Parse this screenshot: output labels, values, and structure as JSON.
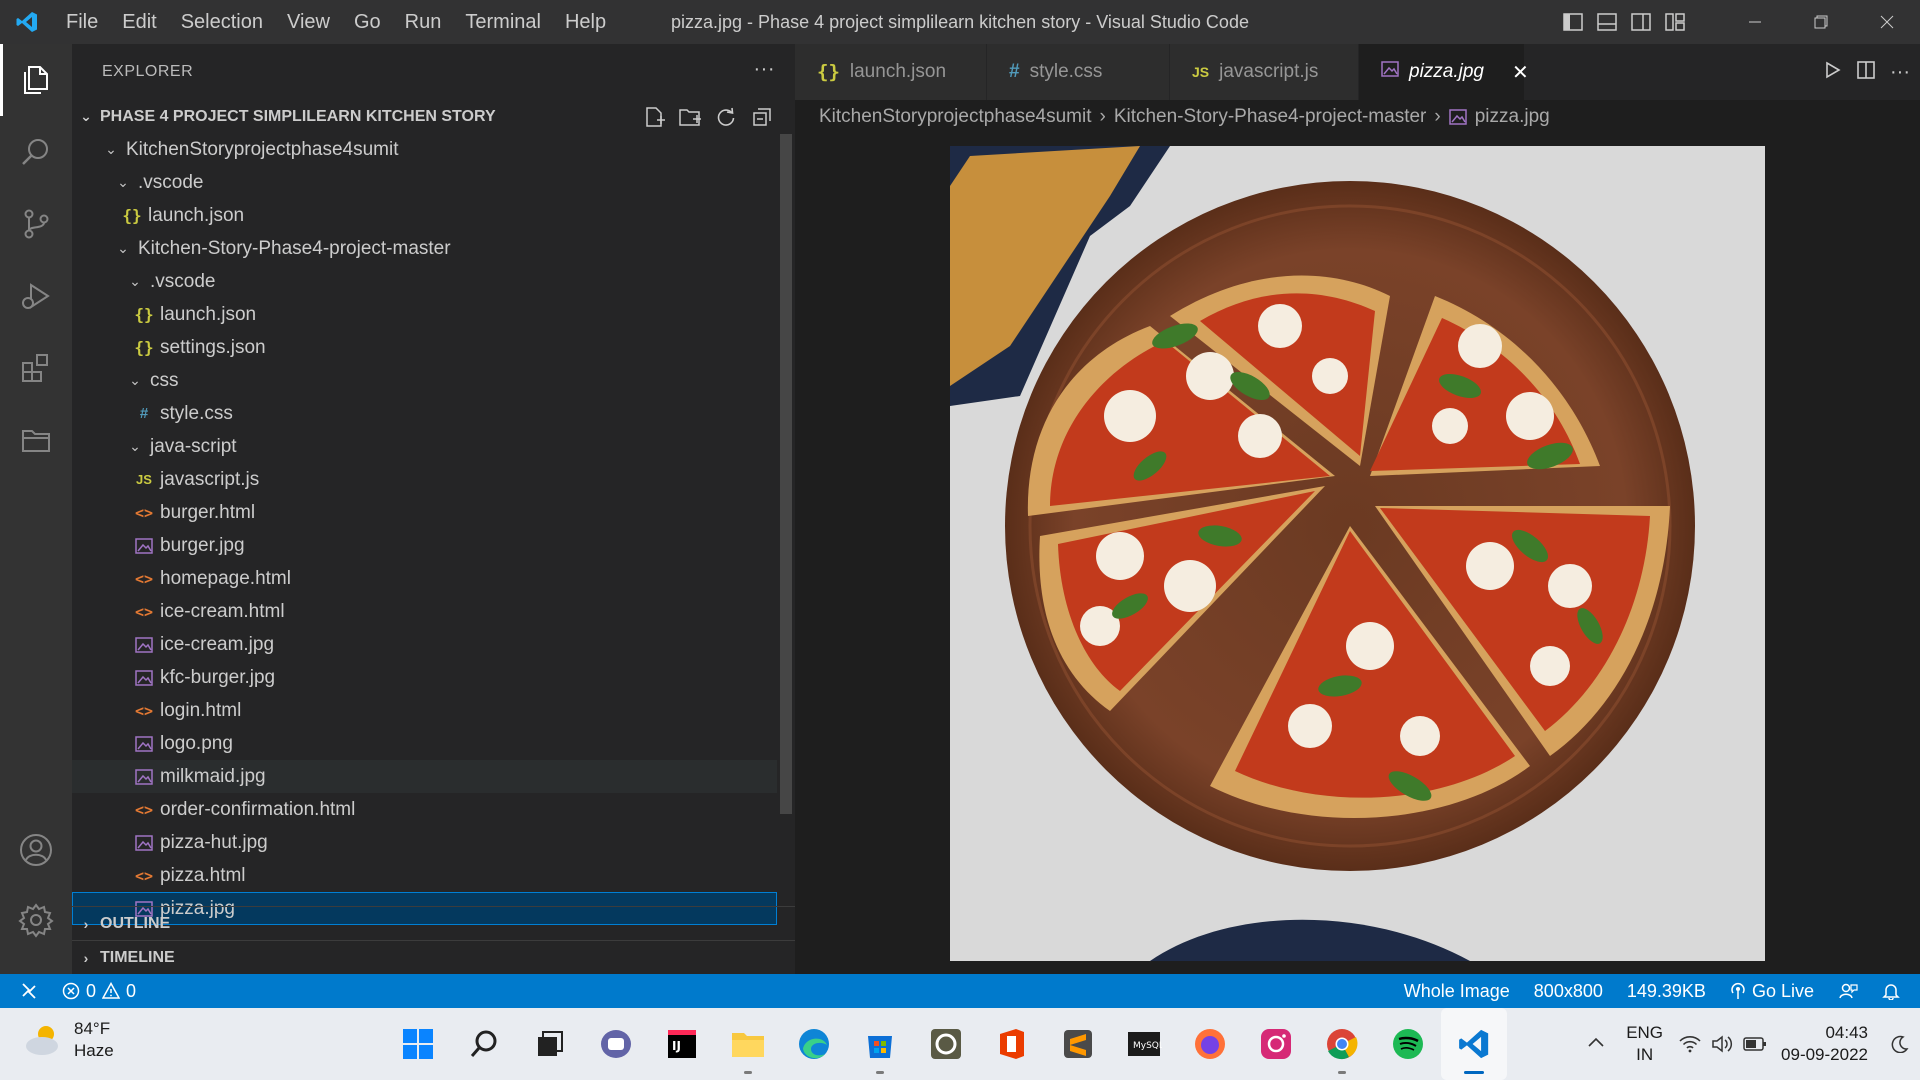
{
  "window": {
    "title": "pizza.jpg - Phase 4 project simplilearn kitchen story - Visual Studio Code",
    "menu": [
      "File",
      "Edit",
      "Selection",
      "View",
      "Go",
      "Run",
      "Terminal",
      "Help"
    ]
  },
  "sidebar": {
    "header": "EXPLORER",
    "more": "···",
    "project_title": "PHASE 4 PROJECT SIMPLILEARN KITCHEN STORY",
    "tree": [
      {
        "label": "KitchenStoryprojectphase4sumit",
        "type": "folder",
        "open": true,
        "level": 1
      },
      {
        "label": ".vscode",
        "type": "folder",
        "open": true,
        "level": 2
      },
      {
        "label": "launch.json",
        "type": "json",
        "level": 2
      },
      {
        "label": "Kitchen-Story-Phase4-project-master",
        "type": "folder",
        "open": true,
        "level": 2
      },
      {
        "label": ".vscode",
        "type": "folder",
        "open": true,
        "level": 3
      },
      {
        "label": "launch.json",
        "type": "json",
        "level": 3
      },
      {
        "label": "settings.json",
        "type": "json",
        "level": 3
      },
      {
        "label": "css",
        "type": "folder",
        "open": true,
        "level": 3
      },
      {
        "label": "style.css",
        "type": "css",
        "level": 3
      },
      {
        "label": "java-script",
        "type": "folder",
        "open": true,
        "level": 3
      },
      {
        "label": "javascript.js",
        "type": "js",
        "level": 3
      },
      {
        "label": "burger.html",
        "type": "html",
        "level": 3
      },
      {
        "label": "burger.jpg",
        "type": "img",
        "level": 3
      },
      {
        "label": "homepage.html",
        "type": "html",
        "level": 3
      },
      {
        "label": "ice-cream.html",
        "type": "html",
        "level": 3
      },
      {
        "label": "ice-cream.jpg",
        "type": "img",
        "level": 3
      },
      {
        "label": "kfc-burger.jpg",
        "type": "img",
        "level": 3
      },
      {
        "label": "login.html",
        "type": "html",
        "level": 3
      },
      {
        "label": "logo.png",
        "type": "img",
        "level": 3
      },
      {
        "label": "milkmaid.jpg",
        "type": "img",
        "level": 3,
        "hover": true
      },
      {
        "label": "order-confirmation.html",
        "type": "html",
        "level": 3
      },
      {
        "label": "pizza-hut.jpg",
        "type": "img",
        "level": 3
      },
      {
        "label": "pizza.html",
        "type": "html",
        "level": 3
      },
      {
        "label": "pizza.jpg",
        "type": "img",
        "level": 3,
        "selected": true
      }
    ],
    "outline": "OUTLINE",
    "timeline": "TIMELINE"
  },
  "tabs": [
    {
      "label": "launch.json",
      "icon": "{}",
      "active": false
    },
    {
      "label": "style.css",
      "icon": "#",
      "active": false
    },
    {
      "label": "javascript.js",
      "icon": "JS",
      "active": false
    },
    {
      "label": "pizza.jpg",
      "icon": "img",
      "active": true
    }
  ],
  "breadcrumb": [
    "KitchenStoryprojectphase4sumit",
    "Kitchen-Story-Phase4-project-master",
    "pizza.jpg"
  ],
  "statusbar": {
    "errors": "0",
    "warnings": "0",
    "zoom": "Whole Image",
    "dimensions": "800x800",
    "size": "149.39KB",
    "golive": "Go Live"
  },
  "taskbar": {
    "temp": "84°F",
    "weather": "Haze",
    "lang1": "ENG",
    "lang2": "IN",
    "time": "04:43",
    "date": "09-09-2022",
    "apps": [
      {
        "name": "start-icon",
        "active": false,
        "dot": false
      },
      {
        "name": "search-icon",
        "active": false,
        "dot": false
      },
      {
        "name": "task-view-icon",
        "active": false,
        "dot": false
      },
      {
        "name": "teams-chat-icon",
        "active": false,
        "dot": false
      },
      {
        "name": "intellij-icon",
        "active": false,
        "dot": false
      },
      {
        "name": "file-explorer-icon",
        "active": false,
        "dot": true
      },
      {
        "name": "edge-icon",
        "active": false,
        "dot": false
      },
      {
        "name": "store-icon",
        "active": false,
        "dot": true
      },
      {
        "name": "app-icon",
        "active": false,
        "dot": false
      },
      {
        "name": "office-icon",
        "active": false,
        "dot": false
      },
      {
        "name": "sublime-icon",
        "active": false,
        "dot": false
      },
      {
        "name": "mysql-icon",
        "active": false,
        "dot": false
      },
      {
        "name": "firefox-icon",
        "active": false,
        "dot": false
      },
      {
        "name": "instagram-icon",
        "active": false,
        "dot": false
      },
      {
        "name": "chrome-icon",
        "active": false,
        "dot": true
      },
      {
        "name": "spotify-icon",
        "active": false,
        "dot": false
      },
      {
        "name": "vscode-icon",
        "active": true,
        "dot": true
      }
    ]
  },
  "colors": {
    "accent": "#007acc",
    "selection": "#04395e",
    "image_file_icon": "#a074c4"
  }
}
